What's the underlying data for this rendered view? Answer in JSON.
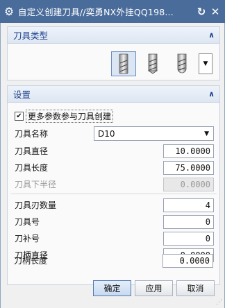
{
  "window": {
    "title": "自定义创建刀具//奕勇NX外挂QQ198...",
    "gear_icon": "gear-icon",
    "refresh_icon": "refresh-icon",
    "close_icon": "close-icon"
  },
  "tool_type_section": {
    "title": "刀具类型",
    "tools": [
      {
        "name": "end-mill",
        "selected": true
      },
      {
        "name": "drill",
        "selected": false
      },
      {
        "name": "ball-mill",
        "selected": false
      }
    ]
  },
  "settings_section": {
    "title": "设置",
    "more_params_label": "更多参数参与刀具创建",
    "more_params_checked": true,
    "tool_name_label": "刀具名称",
    "tool_name_value": "D10",
    "fields": {
      "diameter": {
        "label": "刀具直径",
        "value": "10.0000"
      },
      "length": {
        "label": "刀具长度",
        "value": "75.0000"
      },
      "lower_radius": {
        "label": "刀具下半径",
        "value": "0.0000"
      },
      "flutes": {
        "label": "刀具刃数量",
        "value": "4"
      },
      "tool_number": {
        "label": "刀具号",
        "value": "0"
      },
      "adjust_number": {
        "label": "刀补号",
        "value": "0"
      },
      "holder_diameter": {
        "label": "刀柄直径",
        "value": "0.0000"
      },
      "holder_length": {
        "label": "刀柄长度",
        "value": "0.0000"
      }
    }
  },
  "buttons": {
    "ok": "确定",
    "apply": "应用",
    "cancel": "取消"
  },
  "colors": {
    "titlebar": "#4a6c9b",
    "section_header_text": "#1c3f8c"
  }
}
